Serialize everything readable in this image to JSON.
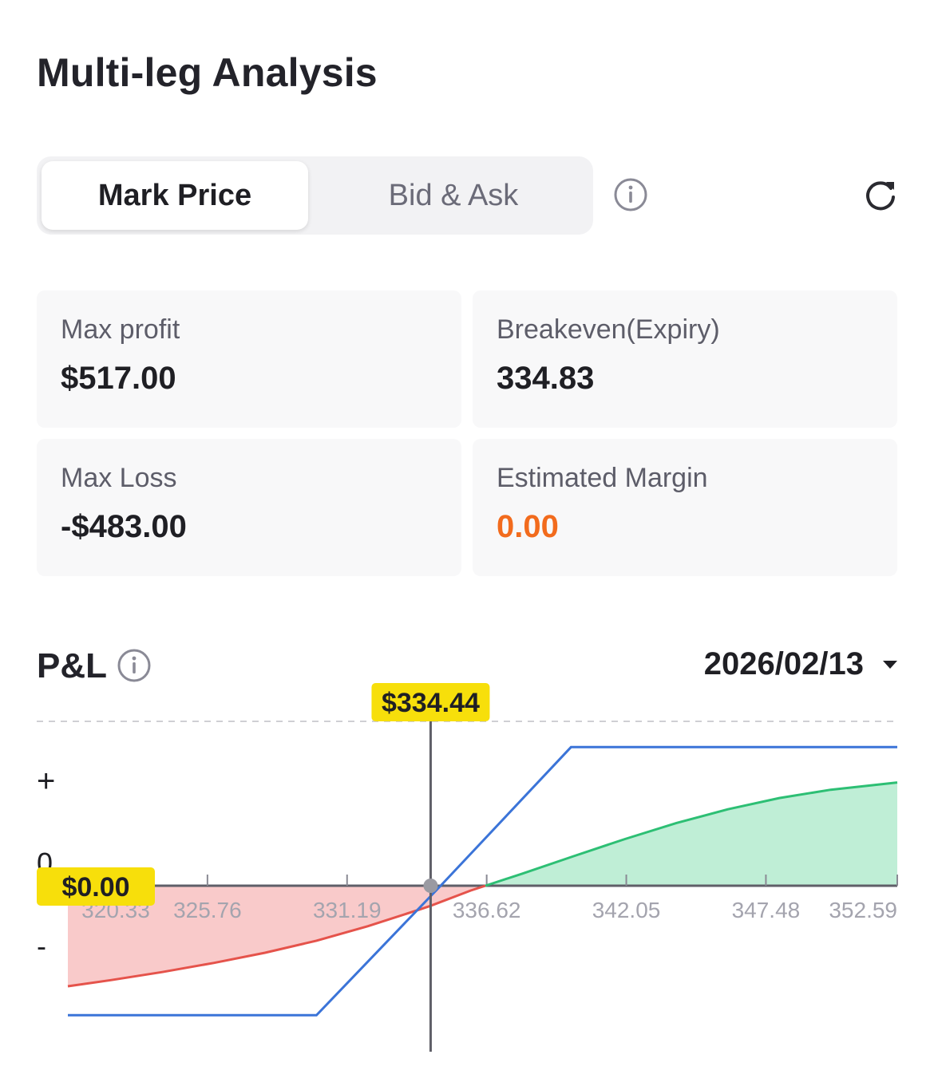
{
  "header": {
    "title": "Multi-leg Analysis"
  },
  "price_mode": {
    "options": [
      "Mark Price",
      "Bid & Ask"
    ],
    "selected": "Mark Price"
  },
  "icons": {
    "info": "info-icon",
    "refresh": "refresh-icon",
    "dropdown": "caret-down-icon"
  },
  "stats": {
    "max_profit": {
      "label": "Max profit",
      "value": "$517.00"
    },
    "breakeven": {
      "label": "Breakeven(Expiry)",
      "value": "334.83"
    },
    "max_loss": {
      "label": "Max Loss",
      "value": "-$483.00"
    },
    "estimated_margin": {
      "label": "Estimated Margin",
      "value": "0.00"
    }
  },
  "pnl": {
    "title": "P&L",
    "date": "2026/02/13"
  },
  "colors": {
    "accent_orange": "#f26b1d",
    "expiry_line": "#3b74d8",
    "profit_curve": "#2dbf74",
    "profit_fill": "#bfeed6",
    "loss_curve": "#e5534b",
    "loss_fill": "#f9caca",
    "marker_bg": "#f7df0b"
  },
  "chart_data": {
    "type": "line",
    "y_axis_labels": [
      "+",
      "0",
      "-"
    ],
    "x_tick_labels": [
      "320.33",
      "325.76",
      "331.19",
      "336.62",
      "342.05",
      "347.48",
      "352.59"
    ],
    "x_ticks": [
      320.33,
      325.76,
      331.19,
      336.62,
      342.05,
      347.48,
      352.59
    ],
    "xlim": [
      320.33,
      352.59
    ],
    "ylim": [
      -600,
      650
    ],
    "current_price_label": "$334.44",
    "current_price": 334.44,
    "zero_label": "$0.00",
    "series": [
      {
        "role": "expiry",
        "x": [
          320.33,
          330.0,
          334.83,
          339.9,
          352.59
        ],
        "y": [
          -483,
          -483,
          0,
          517,
          517
        ]
      },
      {
        "role": "current",
        "x": [
          320.33,
          322.0,
          324.0,
          326.0,
          328.0,
          330.0,
          332.0,
          334.0,
          334.44,
          336.0,
          338.0,
          340.0,
          342.0,
          344.0,
          346.0,
          348.0,
          350.0,
          352.59
        ],
        "y": [
          -375,
          -352,
          -322,
          -288,
          -250,
          -205,
          -151,
          -89,
          -75,
          -18,
          45,
          110,
          174,
          234,
          285,
          327,
          358,
          385
        ]
      }
    ]
  }
}
